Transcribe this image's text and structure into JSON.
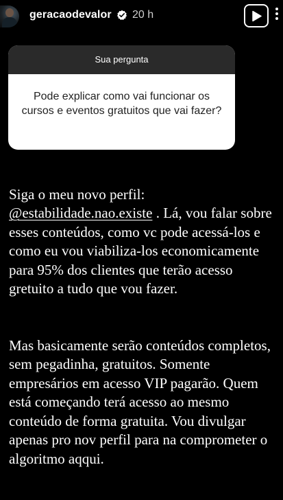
{
  "header": {
    "username": "geracaodevalor",
    "time": "20 h",
    "icons": {
      "verified": "verified-badge-icon",
      "play": "play-icon",
      "more": "more-options-icon"
    }
  },
  "question": {
    "title": "Sua pergunta",
    "text": "Pode explicar como vai funcionar os cursos e eventos gratuitos que vai fazer?"
  },
  "caption": {
    "p1_before": "Siga o meu novo perfil:\n",
    "p1_mention": "@estabilidade.nao.existe",
    "p1_after": " . Lá, vou falar sobre esses conteúdos, como vc pode acessá-los e como eu vou viabiliza-los economicamente para 95% dos clientes que terão acesso gretuito a tudo que vou fazer.",
    "p2": "Mas basicamente serão conteúdos completos, sem pegadinha, gratuitos. Somente empresários em acesso VIP pagarão. Quem está começando terá acesso ao mesmo conteúdo de forma gratuita. Vou divulgar apenas pro nov perfil para na comprometer o algoritmo aqqui."
  }
}
